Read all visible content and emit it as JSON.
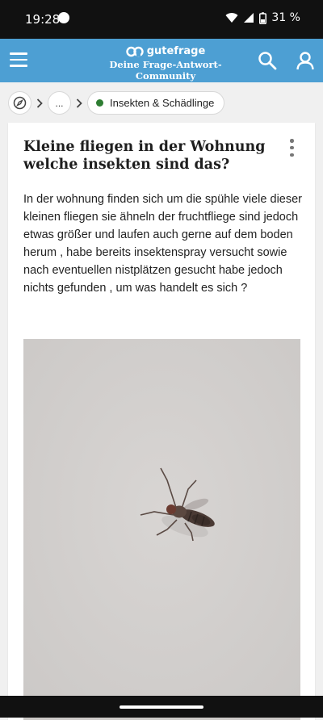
{
  "status_bar": {
    "time": "19:28",
    "battery": "31 %"
  },
  "app_bar": {
    "brand": "gutefrage",
    "tagline": "Deine Frage-Antwort-Community"
  },
  "breadcrumb": {
    "more_label": "...",
    "category": "Insekten & Schädlinge",
    "category_color": "#2e7d32"
  },
  "question": {
    "title": "Kleine fliegen in der Wohnung welche insekten sind das?",
    "body": "In der wohnung finden sich um die spühle viele dieser kleinen fliegen sie ähneln der fruchtfliege sind jedoch etwas größer und laufen auch gerne auf dem boden herum , habe bereits insektenspray versucht sowie nach eventuellen nistplätzen gesucht habe jedoch nichts gefunden , um was handelt es sich ?"
  },
  "colors": {
    "accent": "#4d9fd3",
    "status_bar": "#111111"
  },
  "icons": [
    "menu-icon",
    "logo-icon",
    "search-icon",
    "user-icon",
    "compass-icon",
    "chevron-right-icon",
    "more-vertical-icon"
  ]
}
